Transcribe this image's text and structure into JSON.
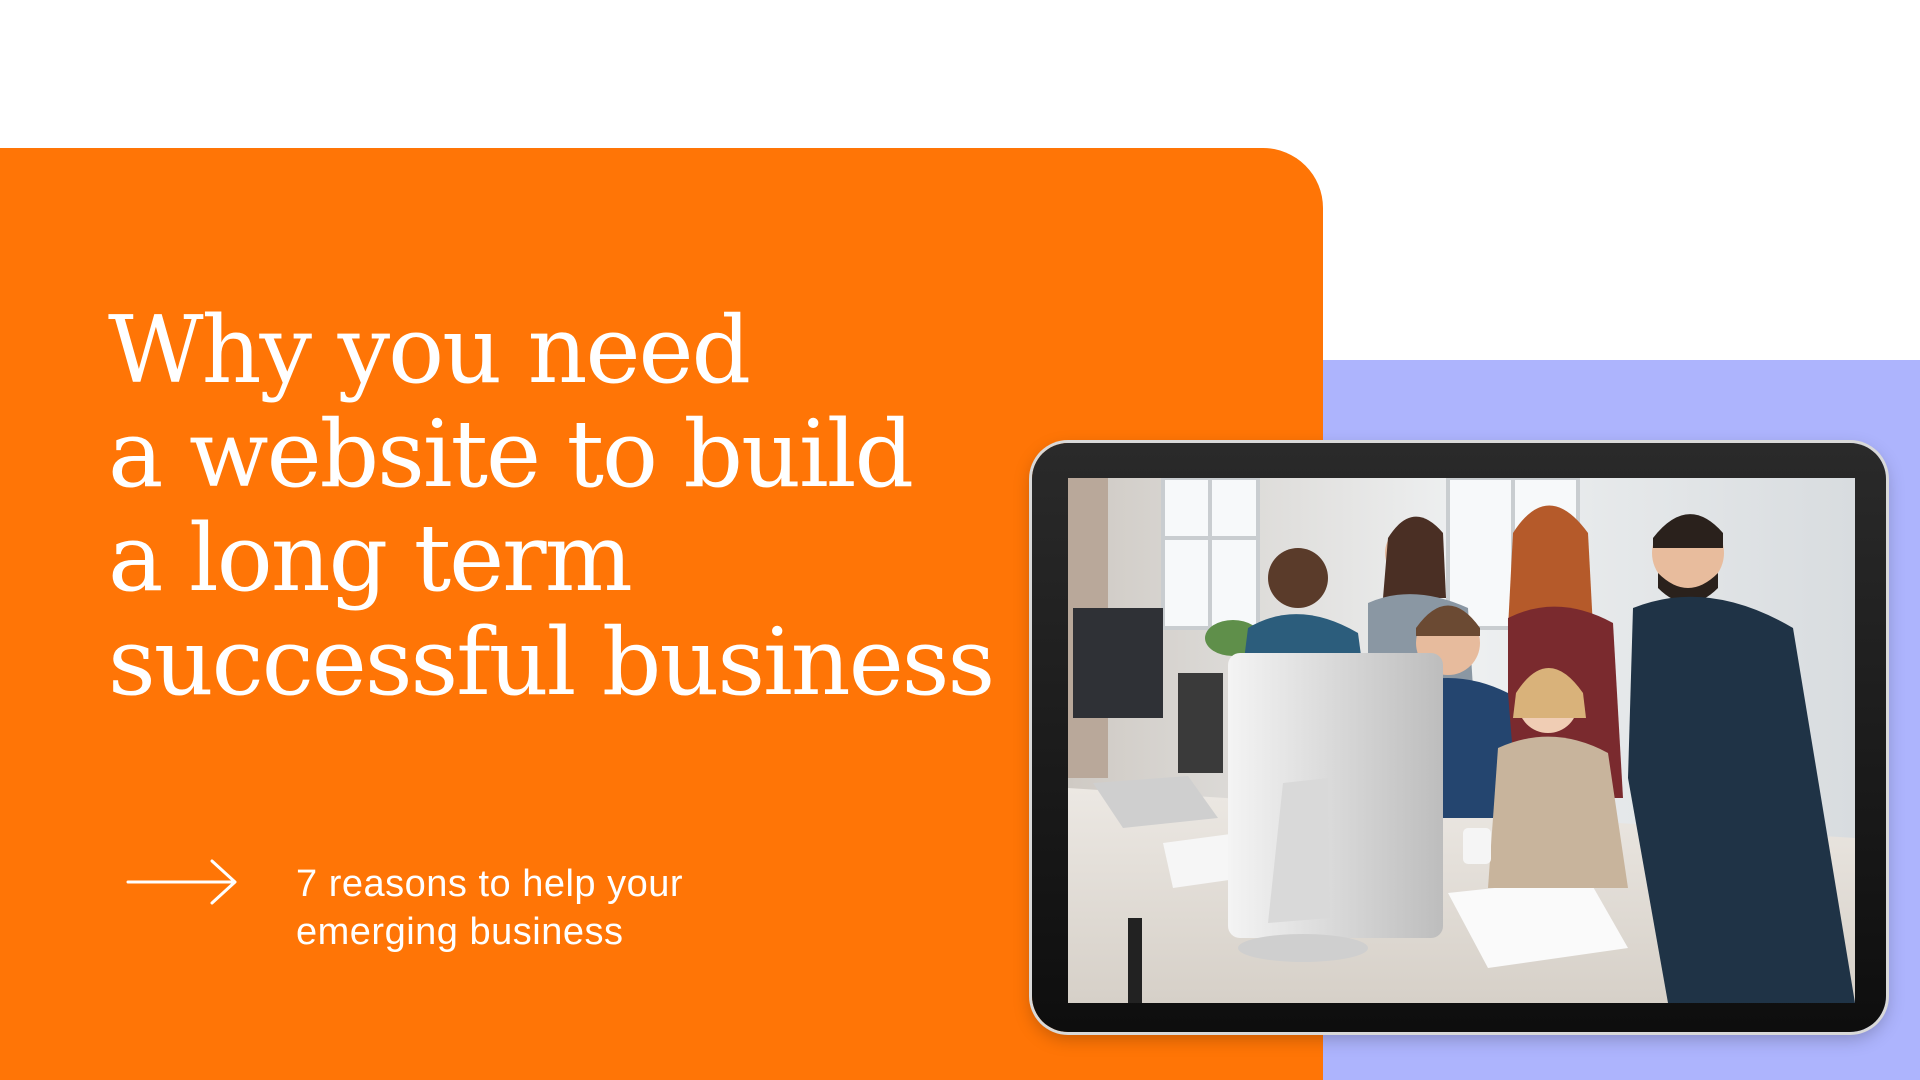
{
  "colors": {
    "orange": "#FF7506",
    "lavender": "#ADB4FD",
    "white": "#FFFFFF"
  },
  "headline": {
    "lines": [
      "Why you need",
      "a website to build",
      "a long term",
      "successful business"
    ]
  },
  "subtitle": {
    "lines": [
      "7 reasons to help your",
      "emerging business"
    ]
  },
  "icons": {
    "arrow": "arrow-right-icon"
  },
  "photo": {
    "subject": "team-around-computer"
  }
}
